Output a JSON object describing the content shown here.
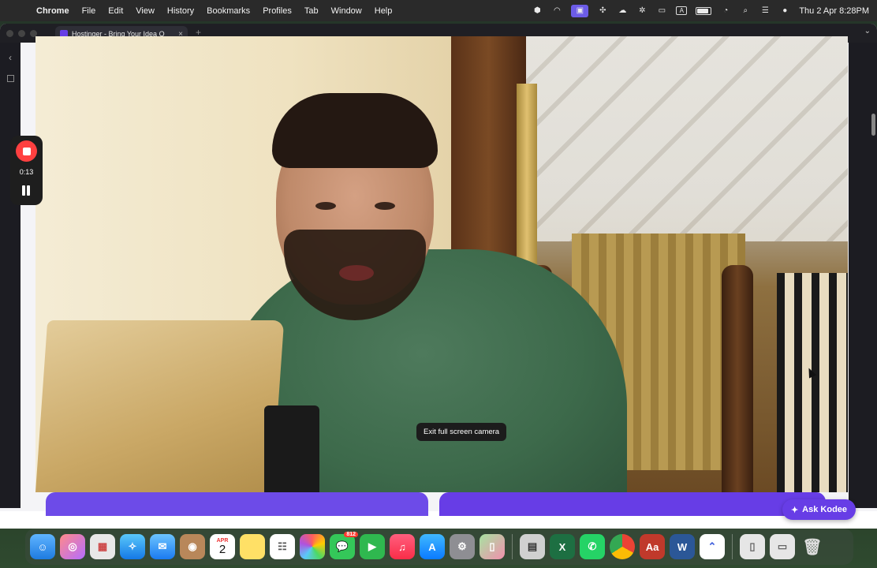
{
  "menubar": {
    "apple": "",
    "items": [
      "Chrome",
      "File",
      "Edit",
      "View",
      "History",
      "Bookmarks",
      "Profiles",
      "Tab",
      "Window",
      "Help"
    ],
    "clock": "Thu 2 Apr  8:28PM",
    "input_label": "A"
  },
  "browser": {
    "tab_title": "Hostinger - Bring Your Idea O",
    "tab_close": "×",
    "new_tab": "+",
    "window_menu": "⌄"
  },
  "recorder": {
    "time": "0:13"
  },
  "camera": {
    "tooltip": "Exit full screen camera"
  },
  "page": {
    "ask_kodee": "Ask Kodee"
  },
  "dock": {
    "calendar_month": "APR",
    "calendar_day": "2",
    "messages_badge": "812",
    "dictionary_label": "Aa"
  },
  "colors": {
    "accent": "#673de6",
    "record": "#ff4040"
  }
}
